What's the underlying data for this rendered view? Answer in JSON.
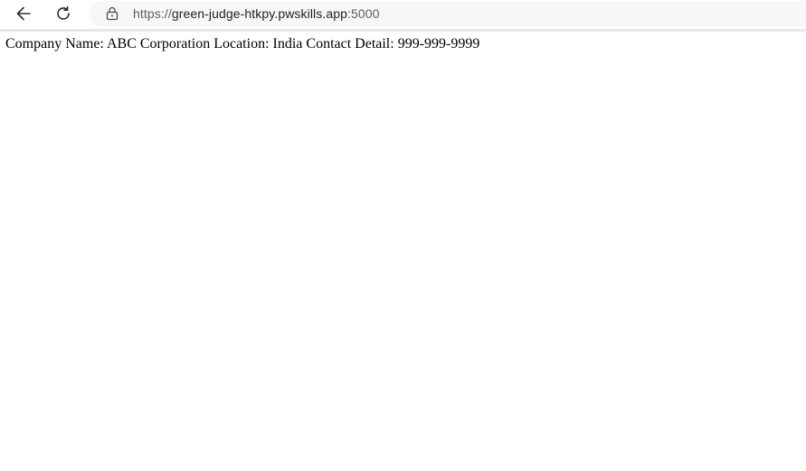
{
  "browser": {
    "back_icon": "arrow-left-icon",
    "reload_icon": "reload-icon",
    "lock_icon": "lock-icon",
    "url": {
      "scheme": "https://",
      "host": "green-judge-htkpy.pwskills.app",
      "port": ":5000"
    }
  },
  "page": {
    "body_text": "Company Name: ABC Corporation Location: India Contact Detail: 999-999-9999"
  }
}
